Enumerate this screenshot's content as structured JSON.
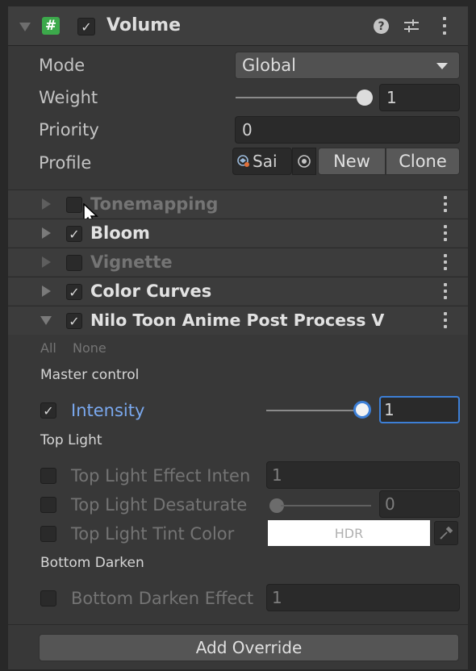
{
  "component": {
    "title": "Volume",
    "help_glyph": "?",
    "settings_glyph": "⇌"
  },
  "properties": {
    "mode_label": "Mode",
    "mode_value": "Global",
    "weight_label": "Weight",
    "weight_value": "1",
    "priority_label": "Priority",
    "priority_value": "0",
    "profile_label": "Profile",
    "profile_value": "Sai",
    "new_button": "New",
    "clone_button": "Clone"
  },
  "overrides": [
    {
      "name": "Tonemapping",
      "enabled": false,
      "expanded": false
    },
    {
      "name": "Bloom",
      "enabled": true,
      "expanded": false
    },
    {
      "name": "Vignette",
      "enabled": false,
      "expanded": false
    },
    {
      "name": "Color Curves",
      "enabled": true,
      "expanded": false
    },
    {
      "name": "Nilo Toon Anime Post Process V",
      "enabled": true,
      "expanded": true
    }
  ],
  "nilo": {
    "all_label": "All",
    "none_label": "None",
    "master_control": "Master control",
    "intensity_label": "Intensity",
    "intensity_value": "1",
    "top_light": "Top Light",
    "top_light_effect_label": "Top Light Effect Inten",
    "top_light_effect_value": "1",
    "top_light_desaturate_label": "Top Light Desaturate",
    "top_light_desaturate_value": "0",
    "top_light_tint_label": "Top Light Tint Color",
    "hdr_label": "HDR",
    "bottom_darken": "Bottom Darken",
    "bottom_darken_label": "Bottom Darken Effect",
    "bottom_darken_value": "1"
  },
  "footer": {
    "add_override": "Add Override"
  },
  "colors": {
    "script_icon": "#3ca94b",
    "intensity_label": "#7aa8ee",
    "focus_border": "#3d7fd6"
  },
  "check_glyph": "✓"
}
